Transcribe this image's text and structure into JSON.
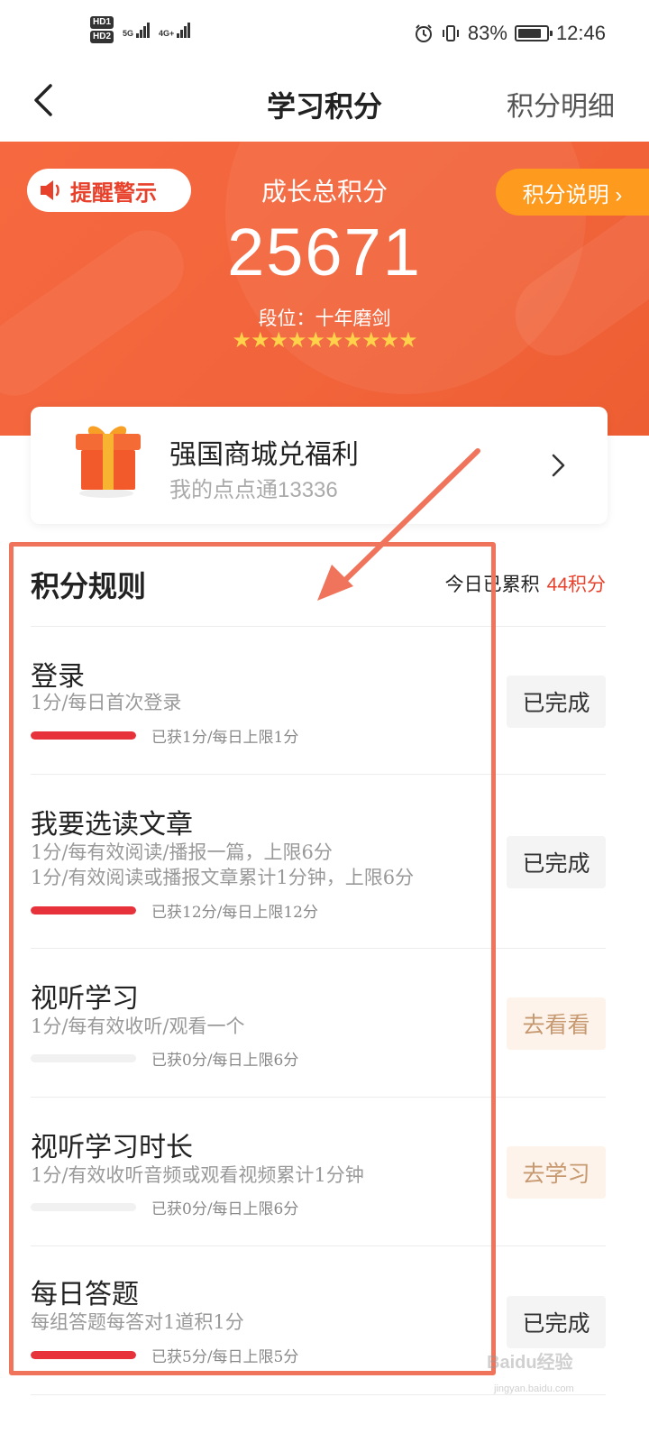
{
  "status_bar": {
    "hd1": "HD1",
    "hd2": "HD2",
    "net1": "5G",
    "net2": "4G+",
    "battery": "83%",
    "time": "12:46",
    "battery_level": 0.83
  },
  "header": {
    "title": "学习积分",
    "detail_link": "积分明细"
  },
  "hero": {
    "alert_label": "提醒警示",
    "explain_label": "积分说明 ›",
    "total_label": "成长总积分",
    "total_value": "25671",
    "rank_prefix": "段位：",
    "rank_value": "十年磨剑",
    "stars": "★★★★★★★★★★",
    "star_color": "#ffd24a",
    "accent": "#f2643b"
  },
  "mall": {
    "title": "强国商城兑福利",
    "subtitle": "我的点点通13336"
  },
  "rules": {
    "title": "积分规则",
    "today_label": "今日已累积",
    "today_points": "44积分",
    "items": [
      {
        "title": "登录",
        "desc": [
          "1分/每日首次登录"
        ],
        "progress_text": "已获1分/每日上限1分",
        "progress": 1.0,
        "button": "已完成",
        "done": true
      },
      {
        "title": "我要选读文章",
        "desc": [
          "1分/每有效阅读/播报一篇，上限6分",
          "1分/有效阅读或播报文章累计1分钟，上限6分"
        ],
        "progress_text": "已获12分/每日上限12分",
        "progress": 1.0,
        "button": "已完成",
        "done": true
      },
      {
        "title": "视听学习",
        "desc": [
          "1分/每有效收听/观看一个"
        ],
        "progress_text": "已获0分/每日上限6分",
        "progress": 0.0,
        "button": "去看看",
        "done": false
      },
      {
        "title": "视听学习时长",
        "desc": [
          "1分/有效收听音频或观看视频累计1分钟"
        ],
        "progress_text": "已获0分/每日上限6分",
        "progress": 0.0,
        "button": "去学习",
        "done": false
      },
      {
        "title": "每日答题",
        "desc": [
          "每组答题每答对1道积1分"
        ],
        "progress_text": "已获5分/每日上限5分",
        "progress": 1.0,
        "button": "已完成",
        "done": true
      }
    ]
  },
  "watermark": {
    "brand": "Baidu经验",
    "url": "jingyan.baidu.com"
  }
}
